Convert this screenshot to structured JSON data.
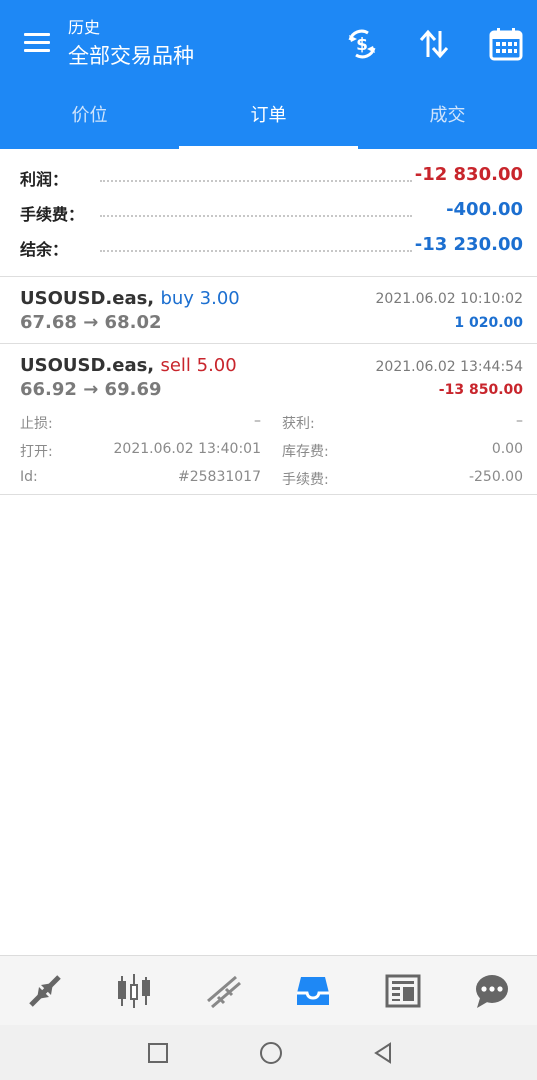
{
  "header": {
    "subtitle": "历史",
    "title": "全部交易品种",
    "icons": [
      "menu-icon",
      "currency-exchange-icon",
      "sort-icon",
      "calendar-icon"
    ],
    "bg_color": "#1e88f5"
  },
  "tabs": [
    {
      "label": "价位",
      "active": false
    },
    {
      "label": "订单",
      "active": true
    },
    {
      "label": "成交",
      "active": false
    }
  ],
  "summary": {
    "profit_label": "利润：",
    "profit_value": "-12 830.00",
    "fee_label": "手续费：",
    "fee_value": "-400.00",
    "balance_label": "结余：",
    "balance_value": "-13 230.00"
  },
  "trades": [
    {
      "symbol": "USOUSD.eas,",
      "side": "buy 3.00",
      "prices": "67.68 → 68.02",
      "time": "2021.06.02 10:10:02",
      "profit": "1 020.00"
    },
    {
      "symbol": "USOUSD.eas,",
      "side": "sell 5.00",
      "prices": "66.92 → 69.69",
      "time": "2021.06.02 13:44:54",
      "profit": "-13 850.00",
      "details": {
        "sl_label": "止损:",
        "sl_value": "–",
        "tp_label": "获利:",
        "tp_value": "–",
        "open_label": "打开:",
        "open_value": "2021.06.02 13:40:01",
        "swap_label": "库存费:",
        "swap_value": "0.00",
        "id_label": "Id:",
        "id_value": "#25831017",
        "fee_label": "手续费:",
        "fee_value": "-250.00"
      }
    }
  ],
  "bottom_nav": [
    {
      "icon": "quotes-arrows-icon",
      "active": false
    },
    {
      "icon": "candlestick-chart-icon",
      "active": false
    },
    {
      "icon": "trade-lines-icon",
      "active": false
    },
    {
      "icon": "history-inbox-icon",
      "active": true
    },
    {
      "icon": "news-icon",
      "active": false
    },
    {
      "icon": "chat-icon",
      "active": false
    }
  ],
  "colors": {
    "accent": "#1e88f5",
    "loss": "#c8252c",
    "gain": "#1c6fd0"
  }
}
